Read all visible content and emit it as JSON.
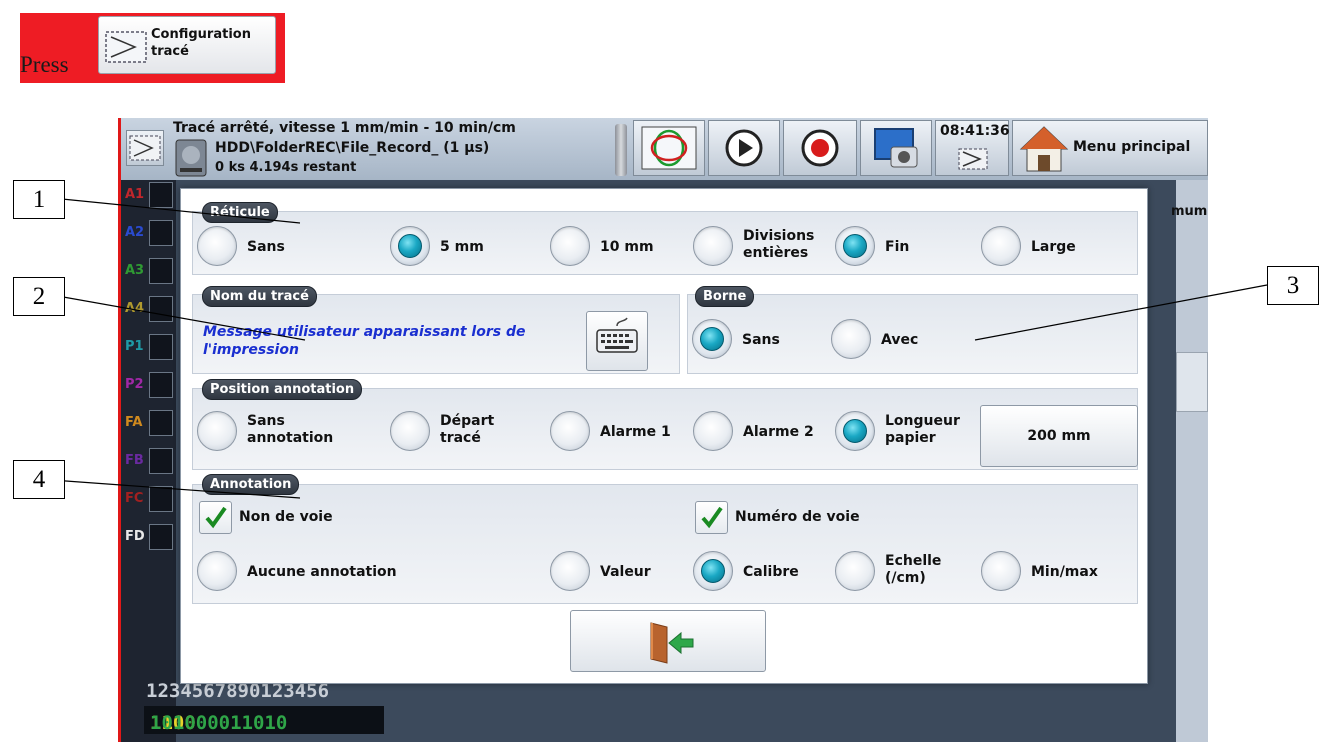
{
  "instruction": {
    "press_text": "Press",
    "button_label_line1": "Configuration",
    "button_label_line2": "tracé"
  },
  "topbar": {
    "status_line1": "Tracé arrêté, vitesse 1 mm/min - 10 min/cm",
    "status_line2": "HDD\\FolderREC\\File_Record_ (1 µs)",
    "status_line3": "0 ks 4.194s restant",
    "clock": "08:41:36",
    "main_menu_label": "Menu principal",
    "behind_text": "mum"
  },
  "channels": [
    {
      "label": "A1",
      "color": "#c0262c"
    },
    {
      "label": "A2",
      "color": "#2a4bd0"
    },
    {
      "label": "A3",
      "color": "#2f9a33"
    },
    {
      "label": "A4",
      "color": "#b09a2e"
    },
    {
      "label": "P1",
      "color": "#1e9aa6"
    },
    {
      "label": "P2",
      "color": "#a028a6"
    },
    {
      "label": "FA",
      "color": "#d08a1e"
    },
    {
      "label": "FB",
      "color": "#6a2aa0"
    },
    {
      "label": "FC",
      "color": "#a32020"
    },
    {
      "label": "FD",
      "color": "#e8e8e8"
    }
  ],
  "digits_line": "1234567890123456",
  "bits_line": {
    "highlight": "1100",
    "rest": "101000011010"
  },
  "dialog": {
    "reticule": {
      "title": "Réticule",
      "options": [
        {
          "label": "Sans",
          "selected": false
        },
        {
          "label": "5 mm",
          "selected": true
        },
        {
          "label": "10 mm",
          "selected": false
        },
        {
          "label": "Divisions entières",
          "line1": "Divisions",
          "line2": "entières",
          "selected": false
        },
        {
          "label": "Fin",
          "selected": true
        },
        {
          "label": "Large",
          "selected": false
        }
      ]
    },
    "nom_du_trace": {
      "title": "Nom du tracé",
      "message_line1": "Message utilisateur apparaissant lors de",
      "message_line2": "l'impression",
      "keyboard_icon": "keyboard-icon"
    },
    "borne": {
      "title": "Borne",
      "options": [
        {
          "label": "Sans",
          "selected": true
        },
        {
          "label": "Avec",
          "selected": false
        }
      ]
    },
    "position_annotation": {
      "title": "Position annotation",
      "options": [
        {
          "label": "Sans annotation",
          "line1": "Sans",
          "line2": "annotation",
          "selected": false
        },
        {
          "label": "Départ tracé",
          "line1": "Départ",
          "line2": "tracé",
          "selected": false
        },
        {
          "label": "Alarme 1",
          "selected": false
        },
        {
          "label": "Alarme 2",
          "selected": false
        },
        {
          "label": "Longueur papier",
          "line1": "Longueur",
          "line2": "papier",
          "selected": true
        }
      ],
      "length_value": "200 mm"
    },
    "annotation": {
      "title": "Annotation",
      "checks": [
        {
          "label": "Non de voie",
          "checked": true
        },
        {
          "label": "Numéro de voie",
          "checked": true
        }
      ],
      "options": [
        {
          "label": "Aucune annotation",
          "selected": false
        },
        {
          "label": "Valeur",
          "selected": false
        },
        {
          "label": "Calibre",
          "selected": true
        },
        {
          "label": "Echelle (/cm)",
          "line1": "Echelle",
          "line2": "(/cm)",
          "selected": false
        },
        {
          "label": "Min/max",
          "selected": false
        }
      ]
    },
    "exit_icon": "exit-door-icon"
  },
  "callouts": [
    "1",
    "2",
    "3",
    "4"
  ],
  "colors": {
    "accent_radio": "#1aa8c4",
    "instruction_red": "#ee1c24",
    "message_blue": "#1a2fd0"
  }
}
